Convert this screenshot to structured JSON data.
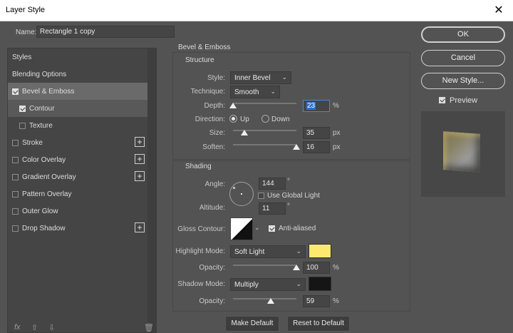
{
  "window": {
    "title": "Layer Style",
    "close_glyph": "✕"
  },
  "name_field": {
    "label": "Name:",
    "value": "Rectangle 1 copy"
  },
  "left_panel": {
    "items": [
      {
        "label": "Styles"
      },
      {
        "label": "Blending Options"
      },
      {
        "label": "Bevel & Emboss",
        "checked": true,
        "selected": true
      },
      {
        "label": "Contour",
        "checked": true,
        "sub": true
      },
      {
        "label": "Texture",
        "checked": false,
        "sub": true
      },
      {
        "label": "Stroke",
        "checked": false,
        "add": true
      },
      {
        "label": "Color Overlay",
        "checked": false,
        "add": true
      },
      {
        "label": "Gradient Overlay",
        "checked": false,
        "add": true
      },
      {
        "label": "Pattern Overlay",
        "checked": false
      },
      {
        "label": "Outer Glow",
        "checked": false
      },
      {
        "label": "Drop Shadow",
        "checked": false,
        "add": true
      }
    ],
    "footer": {
      "fx": "fx",
      "up": "⇧",
      "down": "⇩",
      "trash": "🗑"
    }
  },
  "bevel": {
    "title": "Bevel & Emboss",
    "structure_title": "Structure",
    "style_label": "Style:",
    "style_value": "Inner Bevel",
    "technique_label": "Technique:",
    "technique_value": "Smooth",
    "depth_label": "Depth:",
    "depth_value": "23",
    "depth_unit": "%",
    "depth_slider": 0.0,
    "direction_label": "Direction:",
    "dir_up": "Up",
    "dir_down": "Down",
    "size_label": "Size:",
    "size_value": "35",
    "size_unit": "px",
    "size_slider": 0.18,
    "soften_label": "Soften:",
    "soften_value": "16",
    "soften_unit": "px",
    "soften_slider": 1.0,
    "shading_title": "Shading",
    "angle_label": "Angle:",
    "angle_value": "144",
    "angle_unit": "°",
    "global_light_label": "Use Global Light",
    "global_light_checked": false,
    "altitude_label": "Altitude:",
    "altitude_value": "11",
    "altitude_unit": "°",
    "gloss_label": "Gloss Contour:",
    "anti_aliased_label": "Anti-aliased",
    "anti_aliased_checked": true,
    "highlight_label": "Highlight Mode:",
    "highlight_value": "Soft Light",
    "highlight_color": "#fde96f",
    "h_opacity_label": "Opacity:",
    "h_opacity_value": "100",
    "h_opacity_unit": "%",
    "h_opacity_slider": 1.0,
    "shadow_label": "Shadow Mode:",
    "shadow_value": "Multiply",
    "shadow_color": "#151515",
    "s_opacity_label": "Opacity:",
    "s_opacity_value": "59",
    "s_opacity_unit": "%",
    "s_opacity_slider": 0.59,
    "make_default": "Make Default",
    "reset_default": "Reset to Default"
  },
  "right": {
    "ok": "OK",
    "cancel": "Cancel",
    "new_style": "New Style...",
    "preview_label": "Preview",
    "preview_checked": true
  }
}
